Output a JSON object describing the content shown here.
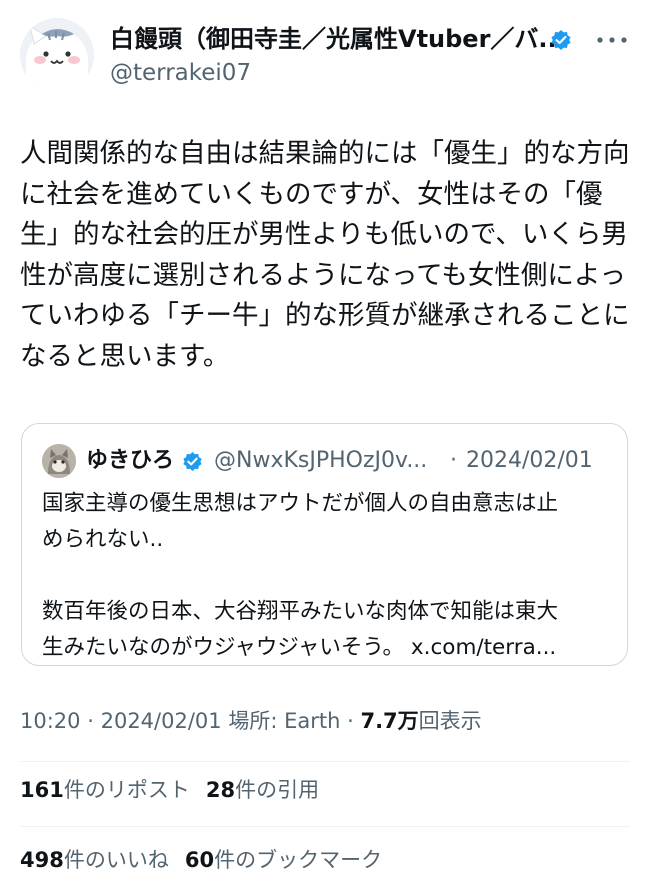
{
  "author": {
    "display_name": "白饅頭（御田寺圭／光属性Vtuber／バ...",
    "handle": "@terrakei07",
    "avatar_icon": "cat-avatar-icon",
    "verified_color": "#1d9bf0"
  },
  "tweet": {
    "text": "人間関係的な自由は結果論的には「優生」的な方向\nに社会を進めていくものですが、女性はその「優\n生」的な社会的圧が男性よりも低いので、いくら男\n性が高度に選別されるようになっても女性側によっ\nていわゆる「チー牛」的な形質が継承されることに\nなると思います。"
  },
  "quote": {
    "name": "ゆきひろ",
    "handle": "@NwxKsJPHOzJ0v...",
    "separator": "·",
    "date": "2024/02/01",
    "text": "国家主導の優生思想はアウトだが個人の自由意志は止\nめられない..\n\n数百年後の日本、大谷翔平みたいな肉体で知能は東大\n生みたいなのがウジャウジャいそう。 ",
    "link": "x.com/terra..."
  },
  "meta": {
    "time": "10:20",
    "separator1": "·",
    "date": "2024/02/01",
    "location": "場所: Earth",
    "separator2": "·",
    "views": "7.7万",
    "views_label": "回表示"
  },
  "stats": {
    "reposts": "161",
    "reposts_label": "件のリポスト",
    "quotes": "28",
    "quotes_label": "件の引用",
    "likes": "498",
    "likes_label": "件のいいね",
    "bookmarks": "60",
    "bookmarks_label": "件のブックマーク"
  }
}
